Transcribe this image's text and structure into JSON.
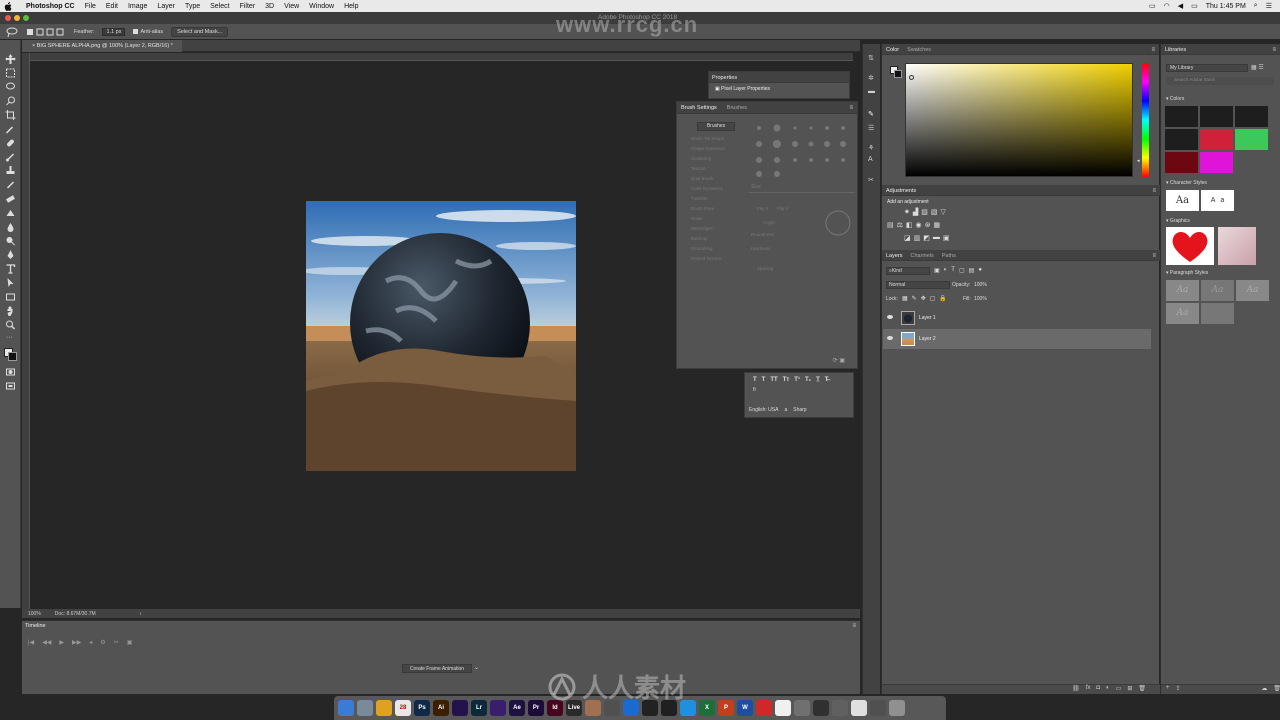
{
  "menubar": {
    "app_name": "Photoshop CC",
    "items": [
      "File",
      "Edit",
      "Image",
      "Layer",
      "Type",
      "Select",
      "Filter",
      "3D",
      "View",
      "Window",
      "Help"
    ],
    "window_title": "Adobe Photoshop CC 2018",
    "clock": "Thu 1:45 PM"
  },
  "options_bar": {
    "feather_label": "Feather:",
    "feather_value": "1.1 px",
    "antialias_label": "Anti-alias",
    "select_mask_label": "Select and Mask..."
  },
  "document": {
    "tab_title": "BIG SPHERE ALPHA.png @ 100% (Layer 2, RGB/16) *",
    "zoom": "100%",
    "doc_info": "Doc: 8.67M/30.7M"
  },
  "timeline": {
    "title": "Timeline",
    "create_label": "Create Frame Animation"
  },
  "properties": {
    "title": "Properties",
    "subtitle": "Pixel Layer Properties"
  },
  "brush_settings": {
    "tab_active": "Brush Settings",
    "tab_other": "Brushes",
    "brushes_button": "Brushes",
    "options": [
      "Brush Tip Shape",
      "Shape Dynamics",
      "Scattering",
      "Texture",
      "Dual Brush",
      "Color Dynamics",
      "Transfer",
      "Brush Pose",
      "Noise",
      "Wet Edges",
      "Build-up",
      "Smoothing",
      "Protect Texture"
    ],
    "size_label": "Size",
    "flip_x": "Flip X",
    "flip_y": "Flip Y",
    "angle_label": "Angle:",
    "roundness_label": "Roundness:",
    "hardness_label": "Hardness",
    "spacing_label": "Spacing"
  },
  "character": {
    "language": "English: USA",
    "aa": "a",
    "aa_mode": "Sharp",
    "ligature": "fi"
  },
  "color_panel": {
    "tab_active": "Color",
    "tab_other": "Swatches"
  },
  "adjustments": {
    "title": "Adjustments",
    "add_label": "Add an adjustment"
  },
  "layers_panel": {
    "tabs": [
      "Layers",
      "Channels",
      "Paths"
    ],
    "filter": "Kind",
    "blend_mode": "Normal",
    "opacity_label": "Opacity:",
    "opacity_value": "100%",
    "lock_label": "Lock:",
    "fill_label": "Fill:",
    "fill_value": "100%",
    "layers": [
      {
        "name": "Layer 1",
        "selected": false
      },
      {
        "name": "Layer 2",
        "selected": true
      }
    ]
  },
  "libraries": {
    "title": "Libraries",
    "library_name": "My Library",
    "search_placeholder": "Search Adobe Stock",
    "colors_label": "Colors",
    "char_styles_label": "Character Styles",
    "graphics_label": "Graphics",
    "para_styles_label": "Paragraph Styles",
    "style_sample": "Aa",
    "style_sample2": "A",
    "style_sample3": "a",
    "swatch_colors": [
      "#1e1e1e",
      "#1e1e1e",
      "#1e1e1e",
      "#1e1e1e",
      "#d0203a",
      "#3cc85a",
      "#6e0810",
      "#e014d8"
    ]
  },
  "watermark": {
    "top": "www.rrcg.cn",
    "bottom": "人人素材"
  },
  "dock": {
    "apps": [
      {
        "label": "",
        "color": "#3a7bd5"
      },
      {
        "label": "",
        "color": "#7a8a9a"
      },
      {
        "label": "",
        "color": "#e0a020"
      },
      {
        "label": "28",
        "color": "#e8e8e8"
      },
      {
        "label": "Ps",
        "color": "#0f2a48"
      },
      {
        "label": "Ai",
        "color": "#3c1e00"
      },
      {
        "label": "",
        "color": "#24124a"
      },
      {
        "label": "Lr",
        "color": "#0c2a3c"
      },
      {
        "label": "",
        "color": "#3a1e6e"
      },
      {
        "label": "Ae",
        "color": "#1e1040"
      },
      {
        "label": "Pr",
        "color": "#1c0a38"
      },
      {
        "label": "Id",
        "color": "#48061e"
      },
      {
        "label": "Live",
        "color": "#2a2a2a"
      },
      {
        "label": "",
        "color": "#a07050"
      },
      {
        "label": "",
        "color": "#505050"
      },
      {
        "label": "",
        "color": "#1a6ad0"
      },
      {
        "label": "",
        "color": "#222222"
      },
      {
        "label": "",
        "color": "#202020"
      },
      {
        "label": "",
        "color": "#1e90e0"
      },
      {
        "label": "X",
        "color": "#1d6f3a"
      },
      {
        "label": "P",
        "color": "#c0401e"
      },
      {
        "label": "W",
        "color": "#1e4ea0"
      },
      {
        "label": "",
        "color": "#d02828"
      },
      {
        "label": "",
        "color": "#f0f0f0"
      },
      {
        "label": "",
        "color": "#707070"
      },
      {
        "label": "",
        "color": "#303030"
      },
      {
        "label": "",
        "color": "#606060"
      },
      {
        "label": "",
        "color": "#e0e0e0"
      },
      {
        "label": "",
        "color": "#505050"
      },
      {
        "label": "",
        "color": "#909090"
      }
    ]
  }
}
